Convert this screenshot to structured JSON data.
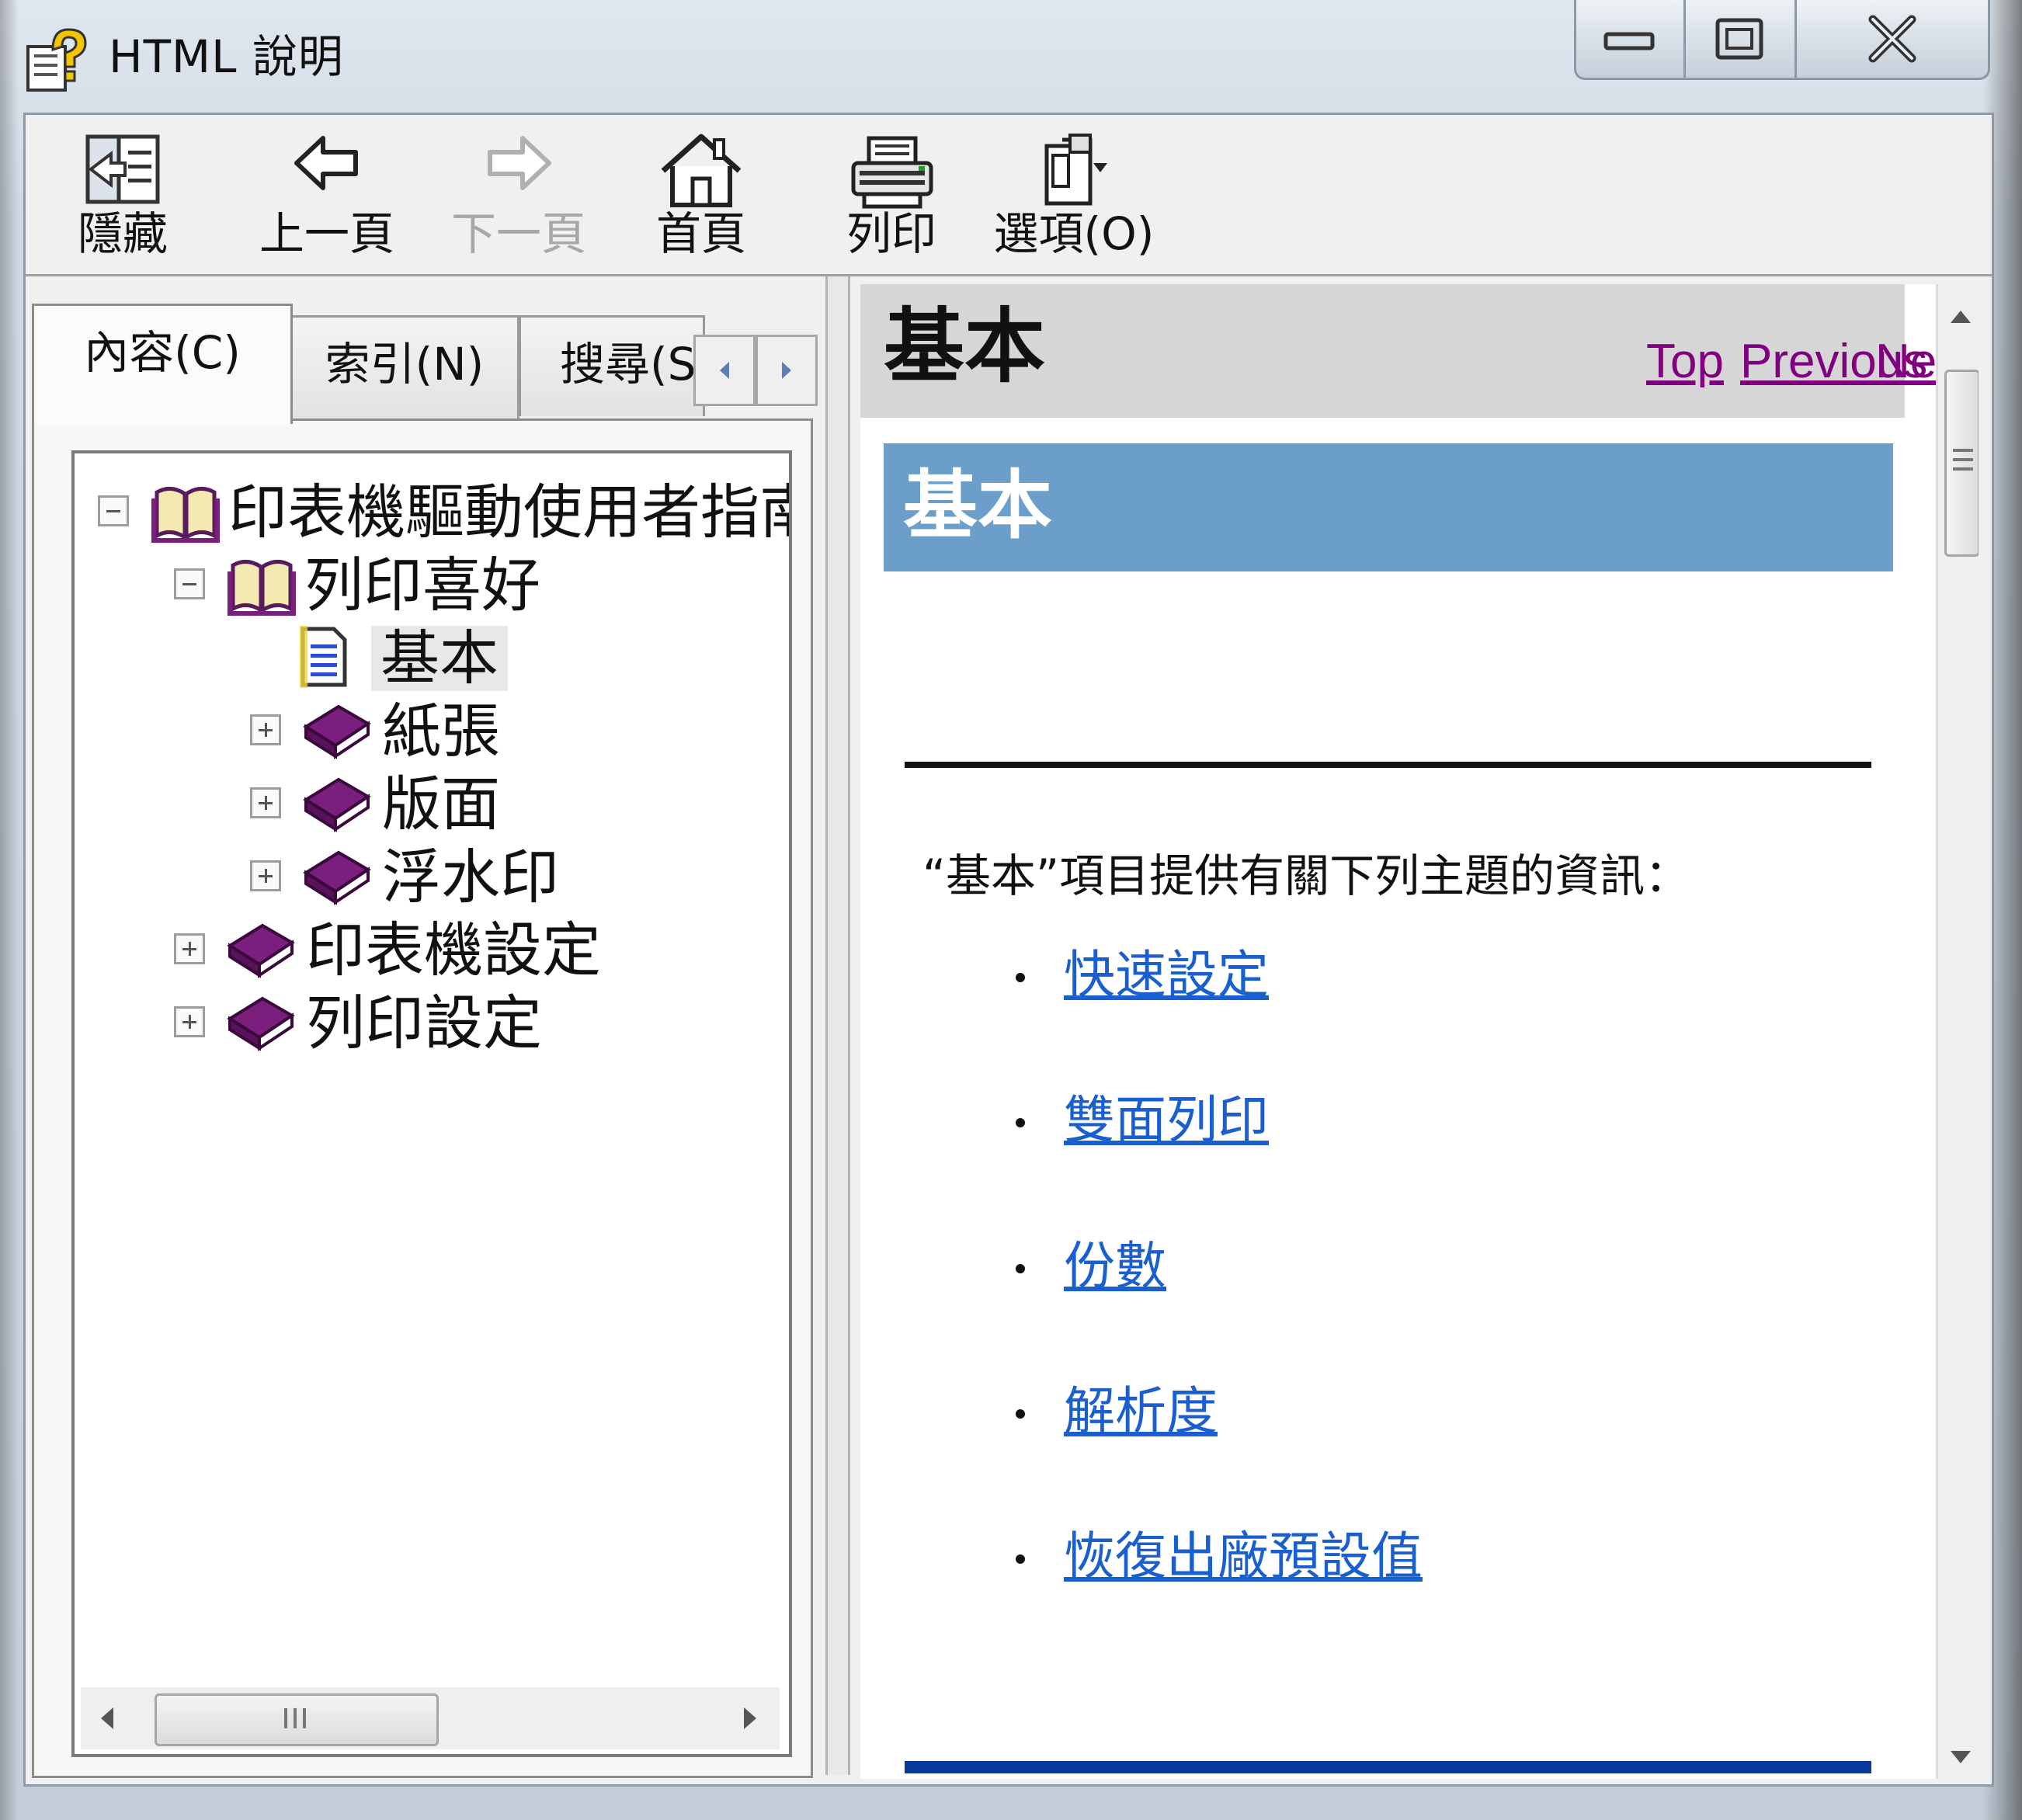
{
  "window": {
    "title": "HTML 說明",
    "controls": {
      "minimize": "minimize",
      "maximize": "maximize",
      "close": "close"
    }
  },
  "toolbar": {
    "hide": "隱藏",
    "back": "上一頁",
    "forward": "下一頁",
    "home": "首頁",
    "print": "列印",
    "options": "選項(O)"
  },
  "nav": {
    "tabs": {
      "contents": "內容(C)",
      "index": "索引(N)",
      "search": "搜尋(S)"
    },
    "tree": {
      "root": "印表機驅動使用者指南",
      "print_prefs": "列印喜好",
      "basic": "基本",
      "paper": "紙張",
      "layout": "版面",
      "watermark": "浮水印",
      "printer_settings": "印表機設定",
      "print_settings": "列印設定"
    }
  },
  "content": {
    "header_title": "基本",
    "nav_links": {
      "top": "Top",
      "previous": "Previous",
      "next": "Next"
    },
    "banner_title": "基本",
    "intro": "“基本”項目提供有關下列主題的資訊：",
    "topics": [
      "快速設定",
      "雙面列印",
      "份數",
      "解析度",
      "恢復出廠預設值"
    ]
  },
  "colors": {
    "banner": "#6b9ec9",
    "visited_link": "#800080",
    "link": "#1a5fd0",
    "book_icon": "#7a1f7e"
  }
}
